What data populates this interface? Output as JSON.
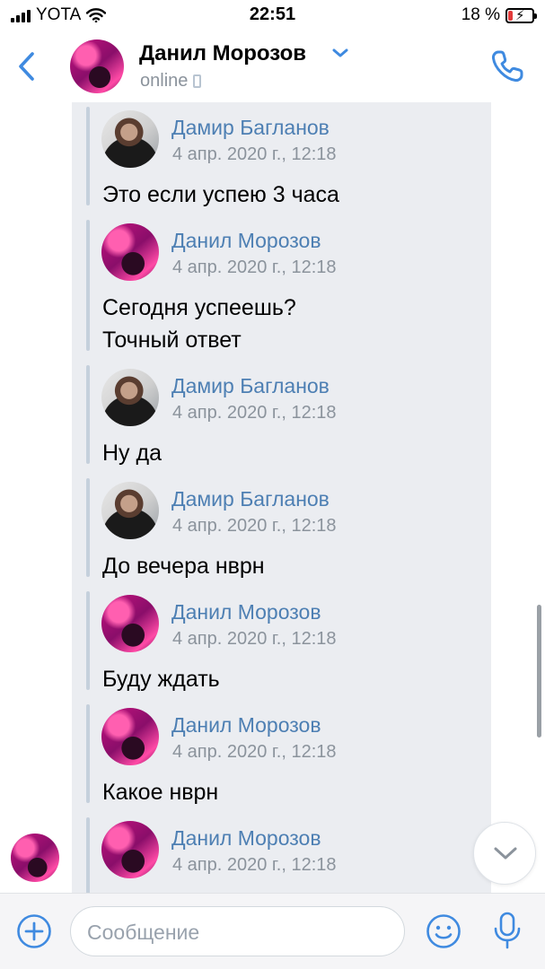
{
  "status_bar": {
    "carrier": "YOTA",
    "time": "22:51",
    "battery_percent": "18 %",
    "battery_level": 0.18,
    "battery_color": "#e23b3b"
  },
  "header": {
    "contact_name": "Данил Морозов",
    "status": "online",
    "icons": [
      "back-chevron-icon",
      "chevron-down-icon",
      "mobile-device-icon",
      "phone-icon"
    ]
  },
  "colors": {
    "accent": "#4d7fb3",
    "bubble_bg": "#ebedf1",
    "secondary_text": "#8b939c"
  },
  "messages": [
    {
      "author": "Дамир Багланов",
      "date": "4 апр. 2020 г., 12:18",
      "text": "Это если успею 3 часа",
      "avatar": "avatar-elon"
    },
    {
      "author": "Данил Морозов",
      "date": "4 апр. 2020 г., 12:18",
      "text": "Сегодня успеешь?\nТочный ответ",
      "avatar": "avatar-pink"
    },
    {
      "author": "Дамир Багланов",
      "date": "4 апр. 2020 г., 12:18",
      "text": "Ну да",
      "avatar": "avatar-elon"
    },
    {
      "author": "Дамир Багланов",
      "date": "4 апр. 2020 г., 12:18",
      "text": "До вечера нврн",
      "avatar": "avatar-elon"
    },
    {
      "author": "Данил Морозов",
      "date": "4 апр. 2020 г., 12:18",
      "text": "Буду ждать",
      "avatar": "avatar-pink"
    },
    {
      "author": "Данил Морозов",
      "date": "4 апр. 2020 г., 12:18",
      "text": "Какое нврн",
      "avatar": "avatar-pink"
    },
    {
      "author": "Данил Морозов",
      "date": "4 апр. 2020 г., 12:18",
      "text": "",
      "avatar": "avatar-pink"
    }
  ],
  "input": {
    "placeholder": "Сообщение",
    "value": ""
  }
}
